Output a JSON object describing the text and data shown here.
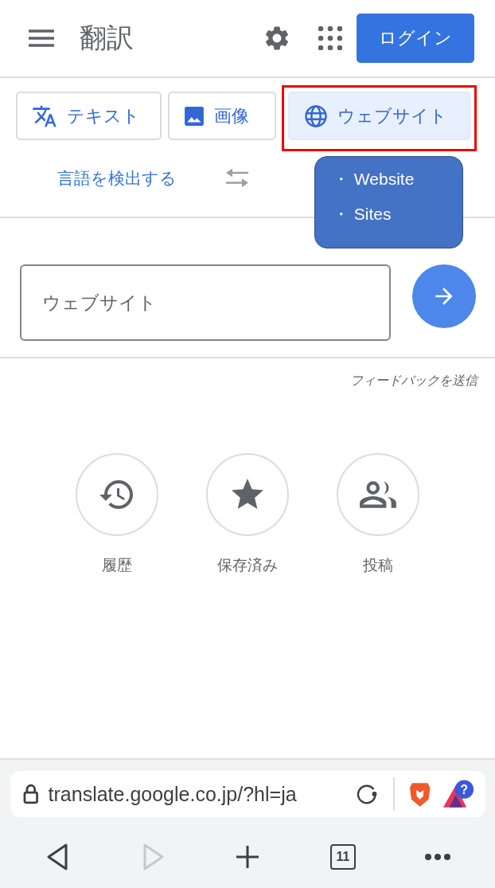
{
  "header": {
    "title": "翻訳",
    "login_button": "ログイン"
  },
  "tabs": [
    {
      "kind": "text",
      "label": "テキスト",
      "selected": false,
      "highlighted": false
    },
    {
      "kind": "image",
      "label": "画像",
      "selected": false,
      "highlighted": false
    },
    {
      "kind": "website",
      "label": "ウェブサイト",
      "selected": true,
      "highlighted": true
    }
  ],
  "annotation": {
    "bullets": [
      "・ Website",
      "・ Sites"
    ]
  },
  "language": {
    "source": "言語を検出する"
  },
  "url_input": {
    "placeholder": "ウェブサイト"
  },
  "feedback_link": "フィードバックを送信",
  "shortcuts": [
    {
      "kind": "history",
      "label": "履歴"
    },
    {
      "kind": "saved",
      "label": "保存済み"
    },
    {
      "kind": "contributions",
      "label": "投稿"
    }
  ],
  "browser": {
    "url": "translate.google.co.jp/?hl=ja",
    "tab_count": "11",
    "badge_mark": "?",
    "forward_disabled": true
  }
}
